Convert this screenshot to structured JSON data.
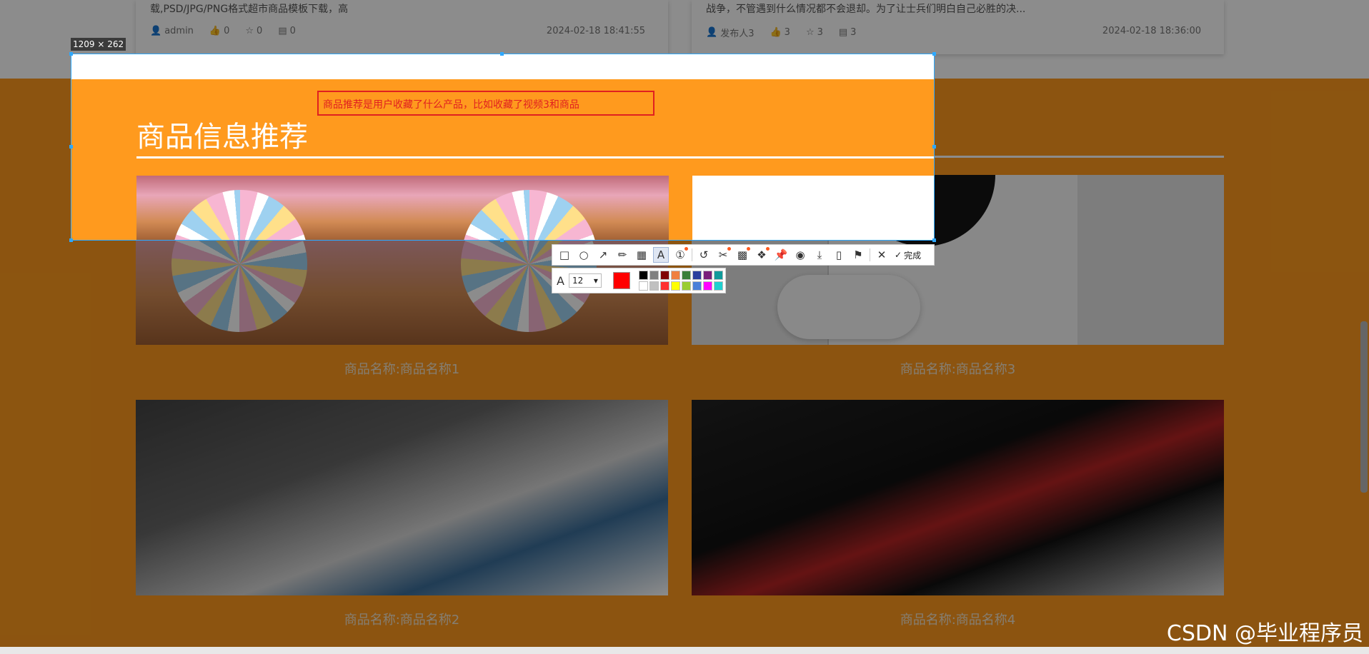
{
  "news_cards": [
    {
      "desc": "载,PSD/JPG/PNG格式超市商品模板下载，高",
      "author": "admin",
      "likes": "0",
      "stars": "0",
      "comments": "0",
      "time": "2024-02-18 18:41:55"
    },
    {
      "desc": "战争，不管遇到什么情况都不会退却。为了让士兵们明白自己必胜的决...",
      "author": "发布人3",
      "likes": "3",
      "stars": "3",
      "comments": "3",
      "time": "2024-02-18 18:36:00"
    }
  ],
  "section": {
    "title": "商品信息推荐"
  },
  "products": [
    {
      "caption": "商品名称:商品名称1"
    },
    {
      "caption": "商品名称:商品名称3"
    },
    {
      "caption": "商品名称:商品名称2"
    },
    {
      "caption": "商品名称:商品名称4"
    }
  ],
  "snip": {
    "size_label": "1209 × 262",
    "annotation_text": "商品推荐是用户收藏了什么产品，比如收藏了视频3和商品",
    "font_size": "12",
    "done_label": "完成",
    "current_color": "#ff0000",
    "palette": [
      "#000000",
      "#808080",
      "#800000",
      "#f08040",
      "#3a7f3a",
      "#2b3f9e",
      "#7a1f7a",
      "#109b9b",
      "#ffffff",
      "#c0c0c0",
      "#ff3030",
      "#ffff00",
      "#9acd32",
      "#4a7fd9",
      "#ff00ff",
      "#20d0d0"
    ]
  },
  "watermark": "CSDN @毕业程序员"
}
